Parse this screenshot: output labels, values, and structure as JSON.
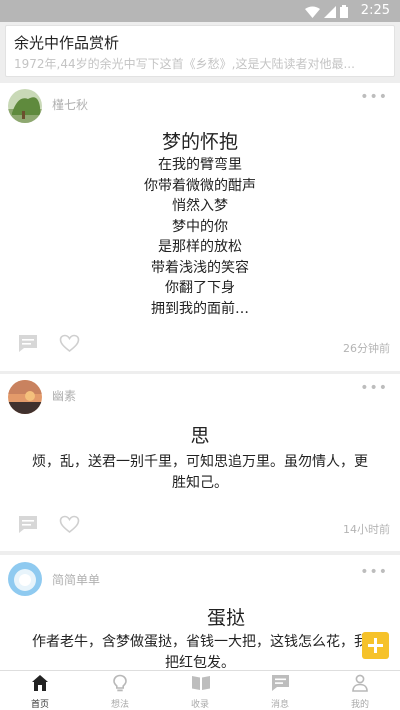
{
  "status_bar": {
    "time": "2:25",
    "icons": [
      "wifi-icon",
      "signal-icon",
      "battery-icon"
    ]
  },
  "top_card": {
    "title": "余光中作品赏析",
    "subtitle": "1972年,44岁的余光中写下这首《乡愁》,这是大陆读者对他最..."
  },
  "posts": [
    {
      "author": "槿七秋",
      "title": "梦的怀抱",
      "lines": [
        "在我的臂弯里",
        "你带着微微的酣声",
        "悄然入梦",
        "梦中的你",
        "是那样的放松",
        "带着浅浅的笑容",
        "你翻了下身",
        "拥到我的面前…"
      ],
      "time": "26分钟前"
    },
    {
      "author": "幽素",
      "title": "思",
      "body": "烦，乱，送君一别千里，可知思追万里。虽勿情人，更胜知己。",
      "time": "14小时前"
    },
    {
      "author": "简简单单",
      "title": "蛋挞",
      "body": "作者老牛，含梦做蛋挞，省钱一大把，这钱怎么花，我把红包发。"
    }
  ],
  "more_glyph": "•••",
  "tabs": [
    {
      "label": "首页",
      "icon": "home-icon",
      "active": true
    },
    {
      "label": "想法",
      "icon": "lightbulb-icon",
      "active": false
    },
    {
      "label": "收录",
      "icon": "book-icon",
      "active": false
    },
    {
      "label": "消息",
      "icon": "message-icon",
      "active": false
    },
    {
      "label": "我的",
      "icon": "person-icon",
      "active": false
    }
  ],
  "colors": {
    "accent": "#f6c22a",
    "status_bar": "#b6b6b6",
    "muted_text": "#b0b0b0"
  }
}
